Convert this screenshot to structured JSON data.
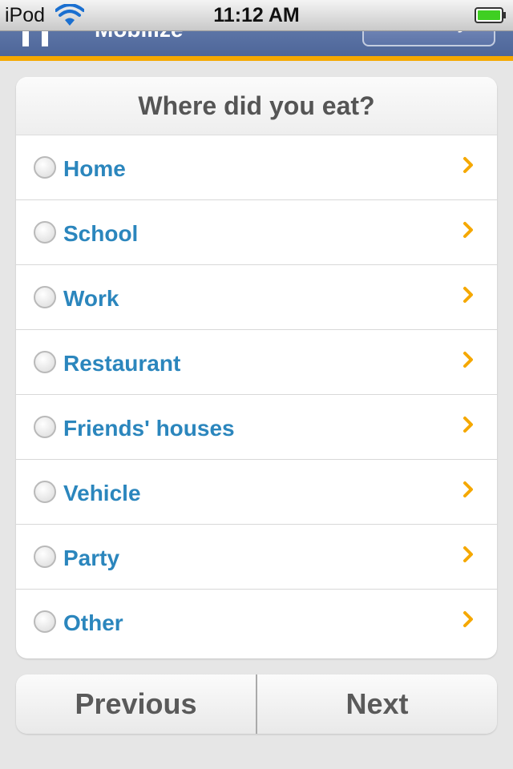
{
  "status_bar": {
    "device": "iPod",
    "time": "11:12 AM",
    "wifi_icon": "wifi-icon",
    "battery_icon": "battery-icon"
  },
  "app_bar": {
    "home_icon": "home-icon",
    "title": "Mobilize",
    "right_button_label": "All Surveys"
  },
  "question": {
    "title": "Where did you eat?",
    "options": [
      {
        "label": "Home"
      },
      {
        "label": "School"
      },
      {
        "label": "Work"
      },
      {
        "label": "Restaurant"
      },
      {
        "label": "Friends' houses"
      },
      {
        "label": "Vehicle"
      },
      {
        "label": "Party"
      },
      {
        "label": "Other"
      }
    ]
  },
  "navigation": {
    "previous_label": "Previous",
    "next_label": "Next"
  },
  "colors": {
    "option_text": "#2b86bd",
    "chevron": "#f5a800",
    "header_accent": "#f5a800",
    "header_bg": "#5a72a6"
  }
}
